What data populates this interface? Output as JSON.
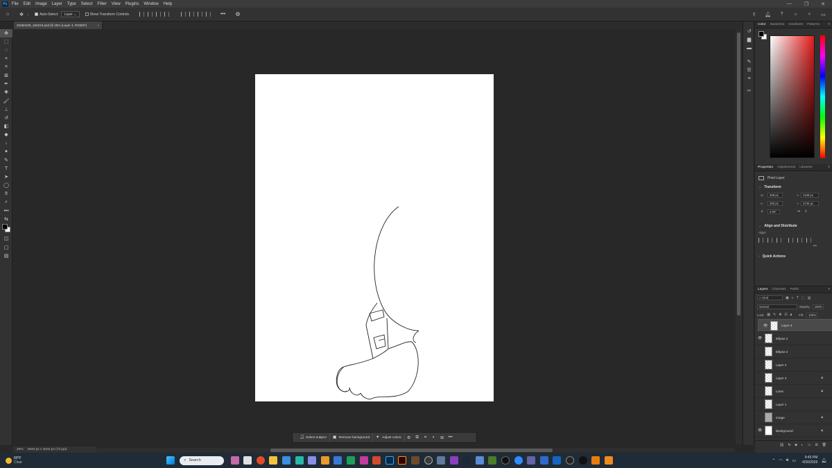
{
  "app": {
    "logo": "Ps"
  },
  "menu": [
    "File",
    "Edit",
    "Image",
    "Layer",
    "Type",
    "Select",
    "Filter",
    "View",
    "Plugins",
    "Window",
    "Help"
  ],
  "options_bar": {
    "auto_select_label": "Auto-Select:",
    "auto_select_target": "Layer",
    "show_transform_label": "Show Transform Controls"
  },
  "document_tab": {
    "title": "20260430_155316.psd @ 25% (Layer 4, RGB/8*)",
    "close": "×"
  },
  "status": {
    "zoom": "25%",
    "doc_size": "2940 px x 4032 px (72 ppi)"
  },
  "context_bar": {
    "select_subject": "Select subject",
    "remove_background": "Remove background",
    "adjust_colors": "Adjust colors"
  },
  "color_panel": {
    "tabs": [
      "Color",
      "Swatches",
      "Gradients",
      "Patterns"
    ],
    "active": "Color",
    "hue_color": "#e41c1c"
  },
  "properties_panel": {
    "tabs": [
      "Properties",
      "Adjustments",
      "Libraries"
    ],
    "layer_kind": "Pixel Layer",
    "transform_title": "Transform",
    "w": "408 px",
    "x": "1139 px",
    "h": "200 px",
    "y": "3745 px",
    "angle": "0.00°",
    "align_title": "Align and Distribute",
    "align_label": "Align:",
    "quick_actions_title": "Quick Actions",
    "more": "•••"
  },
  "layers_panel": {
    "tabs": [
      "Layers",
      "Channels",
      "Paths"
    ],
    "filter": "Kind",
    "blend_mode": "Normal",
    "opacity_label": "Opacity:",
    "opacity": "100%",
    "lock_label": "Lock:",
    "fill_label": "Fill:",
    "fill": "100%",
    "layers": [
      {
        "name": "Layer 4",
        "visible": true,
        "selected": true,
        "locked": false
      },
      {
        "name": "Ellipse 2",
        "visible": true,
        "selected": false,
        "locked": false
      },
      {
        "name": "Ellipse 2",
        "visible": false,
        "selected": false,
        "locked": false
      },
      {
        "name": "Layer 2",
        "visible": false,
        "selected": false,
        "locked": false
      },
      {
        "name": "Layer 3",
        "visible": false,
        "selected": false,
        "locked": true
      },
      {
        "name": "Lines",
        "visible": false,
        "selected": false,
        "locked": true
      },
      {
        "name": "Layer 1",
        "visible": false,
        "selected": false,
        "locked": false
      },
      {
        "name": "Image",
        "visible": false,
        "selected": false,
        "locked": true
      },
      {
        "name": "Background",
        "visible": true,
        "selected": false,
        "locked": true
      }
    ]
  },
  "taskbar": {
    "weather_temp": "60°F",
    "weather_desc": "Clear",
    "search_placeholder": "Search",
    "time": "9:45 PM",
    "date": "4/30/2026"
  }
}
